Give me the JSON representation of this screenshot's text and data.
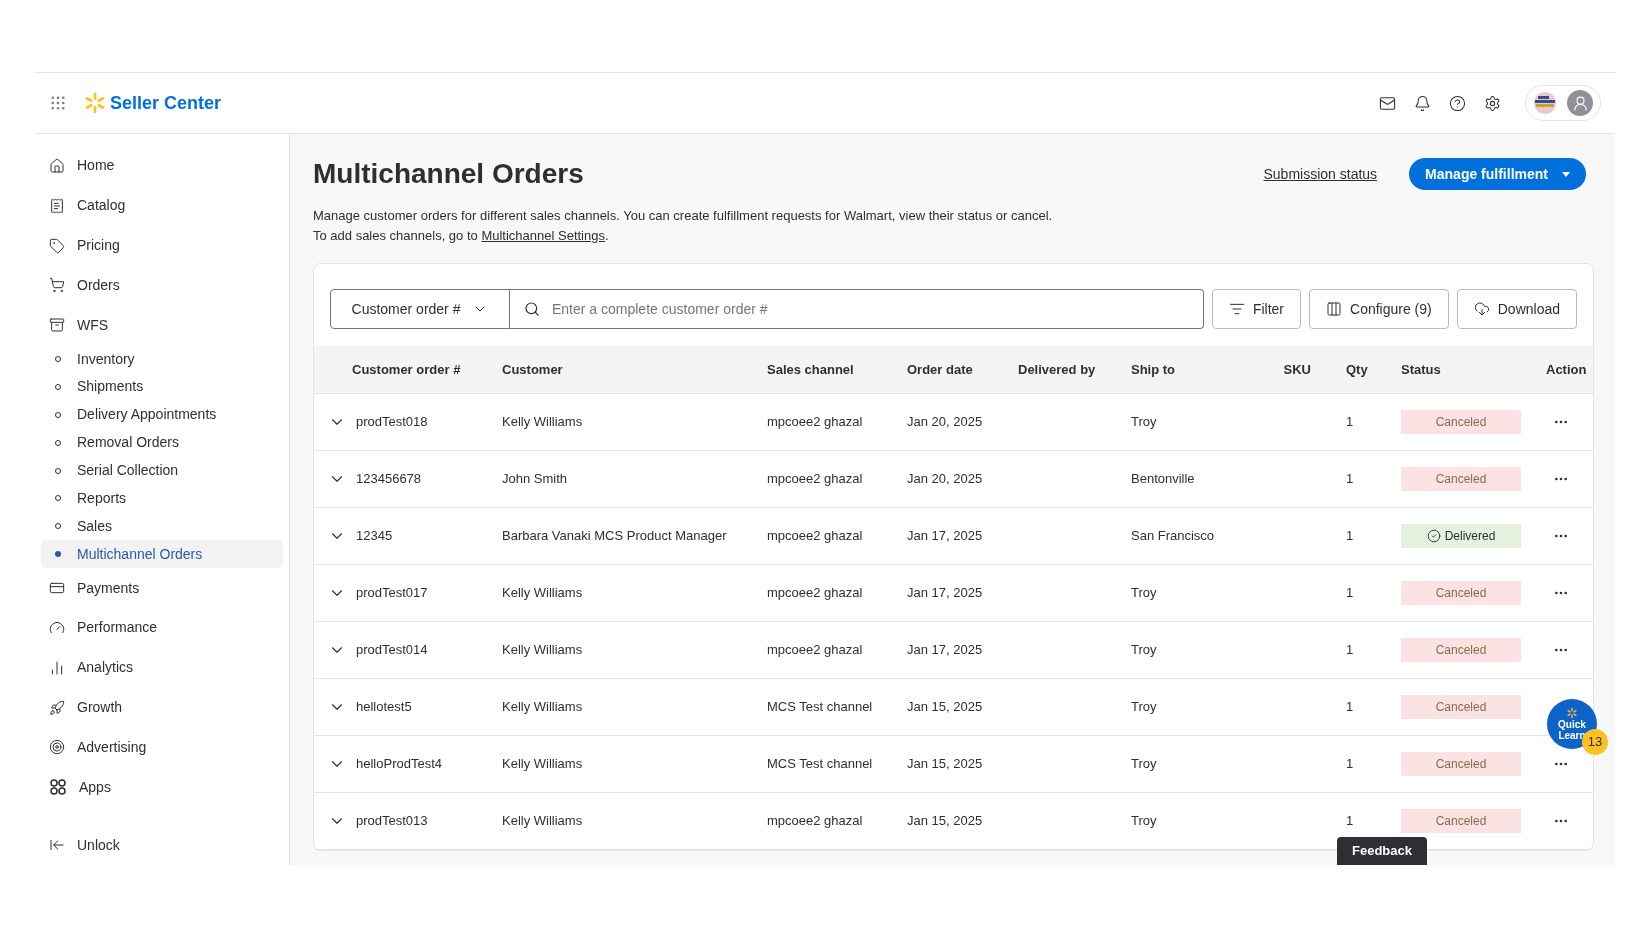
{
  "header": {
    "brand": "Seller Center"
  },
  "sidebar": {
    "items": [
      {
        "label": "Home",
        "selected": false
      },
      {
        "label": "Catalog",
        "selected": false
      },
      {
        "label": "Pricing",
        "selected": false
      },
      {
        "label": "Orders",
        "selected": false
      },
      {
        "label": "WFS",
        "selected": false,
        "children": [
          {
            "label": "Inventory",
            "selected": false
          },
          {
            "label": "Shipments",
            "selected": false
          },
          {
            "label": "Delivery Appointments",
            "selected": false
          },
          {
            "label": "Removal Orders",
            "selected": false
          },
          {
            "label": "Serial Collection",
            "selected": false
          },
          {
            "label": "Reports",
            "selected": false
          },
          {
            "label": "Sales",
            "selected": false
          },
          {
            "label": "Multichannel Orders",
            "selected": true
          }
        ]
      },
      {
        "label": "Payments",
        "selected": false
      },
      {
        "label": "Performance",
        "selected": false
      },
      {
        "label": "Analytics",
        "selected": false
      },
      {
        "label": "Growth",
        "selected": false
      },
      {
        "label": "Advertising",
        "selected": false
      },
      {
        "label": "Apps",
        "selected": false
      }
    ],
    "footer": "Unlock"
  },
  "page": {
    "title": "Multichannel Orders",
    "link": "Submission status",
    "primary_button": "Manage fulfillment",
    "description": "Manage customer orders for different sales channels. You can create fulfillment requests for Walmart, view their status or cancel.",
    "settings_prefix": "To add sales channels, go to ",
    "settings_link": "Multichannel Settings",
    "settings_suffix": "."
  },
  "toolbar": {
    "search_by": "Customer order #",
    "search": {
      "placeholder": "Enter a complete customer order #"
    },
    "buttons": [
      "Filter",
      "Configure (9)",
      "Download"
    ]
  },
  "table": {
    "columns": [
      "Customer order #",
      "Customer",
      "Sales channel",
      "Order date",
      "Delivered by",
      "Ship to",
      "SKU",
      "Qty",
      "Status",
      "Action"
    ],
    "rows": [
      {
        "order": "prodTest018",
        "customer": "Kelly Williams",
        "channel": "mpcoee2 ghazal",
        "date": "Jan 20, 2025",
        "ship_to": "Troy",
        "qty": "1",
        "status": {
          "text": "Canceled",
          "kind": "canceled"
        }
      },
      {
        "order": "123456678",
        "customer": "John Smith",
        "channel": "mpcoee2 ghazal",
        "date": "Jan 20, 2025",
        "ship_to": "Bentonville",
        "qty": "1",
        "status": {
          "text": "Canceled",
          "kind": "canceled"
        }
      },
      {
        "order": "12345",
        "customer": "Barbara Vanaki MCS Product Manager",
        "channel": "mpcoee2 ghazal",
        "date": "Jan 17, 2025",
        "ship_to": "San Francisco",
        "qty": "1",
        "status": {
          "text": "Delivered",
          "kind": "delivered"
        }
      },
      {
        "order": "prodTest017",
        "customer": "Kelly Williams",
        "channel": "mpcoee2 ghazal",
        "date": "Jan 17, 2025",
        "ship_to": "Troy",
        "qty": "1",
        "status": {
          "text": "Canceled",
          "kind": "canceled"
        }
      },
      {
        "order": "prodTest014",
        "customer": "Kelly Williams",
        "channel": "mpcoee2 ghazal",
        "date": "Jan 17, 2025",
        "ship_to": "Troy",
        "qty": "1",
        "status": {
          "text": "Canceled",
          "kind": "canceled"
        }
      },
      {
        "order": "hellotest5",
        "customer": "Kelly Williams",
        "channel": "MCS Test channel",
        "date": "Jan 15, 2025",
        "ship_to": "Troy",
        "qty": "1",
        "status": {
          "text": "Canceled",
          "kind": "canceled"
        }
      },
      {
        "order": "helloProdTest4",
        "customer": "Kelly Williams",
        "channel": "MCS Test channel",
        "date": "Jan 15, 2025",
        "ship_to": "Troy",
        "qty": "1",
        "status": {
          "text": "Canceled",
          "kind": "canceled"
        }
      },
      {
        "order": "prodTest013",
        "customer": "Kelly Williams",
        "channel": "mpcoee2 ghazal",
        "date": "Jan 15, 2025",
        "ship_to": "Troy",
        "qty": "1",
        "status": {
          "text": "Canceled",
          "kind": "canceled"
        }
      }
    ]
  },
  "quick_learn": {
    "label": "Quick Learn",
    "badge": "13"
  },
  "feedback": "Feedback"
}
